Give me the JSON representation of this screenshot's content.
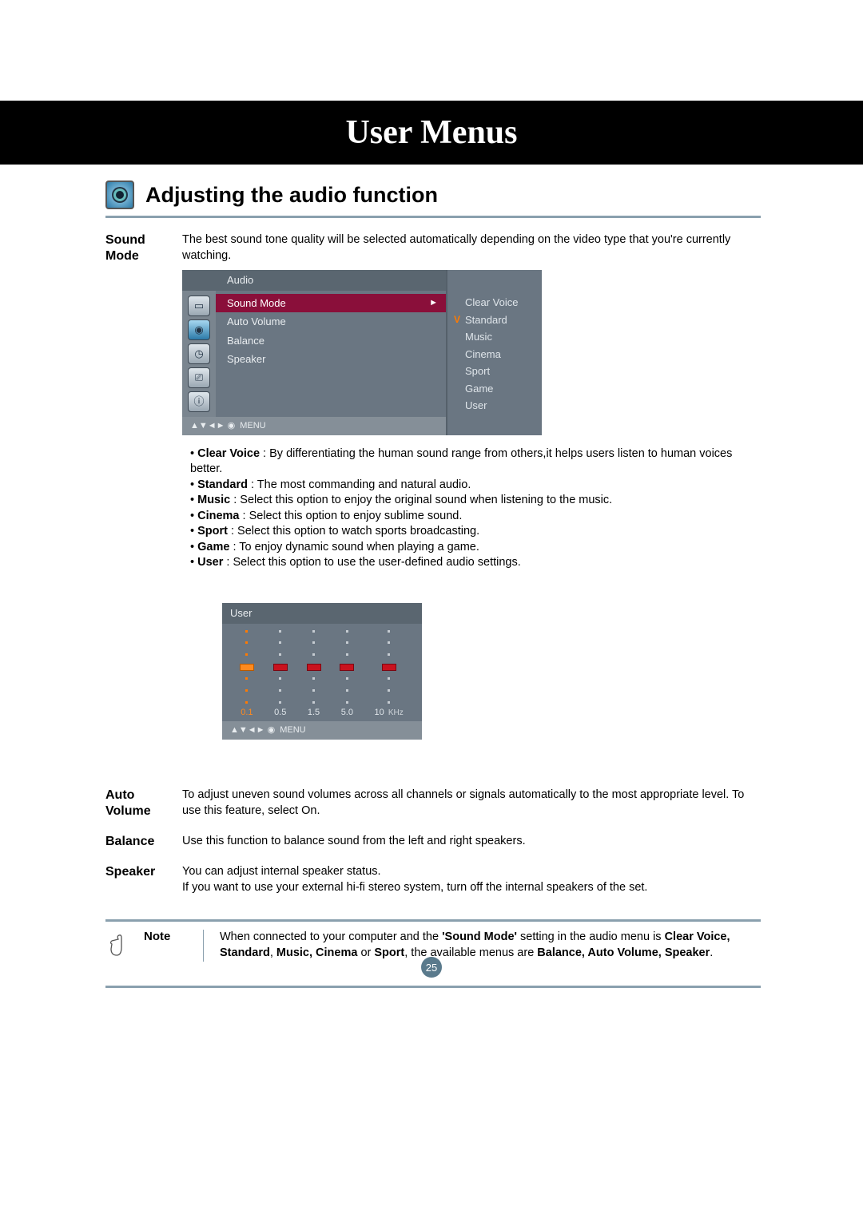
{
  "banner_title": "User Menus",
  "section_title": "Adjusting the audio function",
  "page_number": "25",
  "sound_mode": {
    "label_line1": "Sound",
    "label_line2": "Mode",
    "intro": "The best sound tone quality will be selected automatically depending on the video type that you're currently watching."
  },
  "osd": {
    "title": "Audio",
    "items": [
      "Sound Mode",
      "Auto Volume",
      "Balance",
      "Speaker"
    ],
    "selected_index": 0,
    "footer_nav": "▲▼◄► ◉",
    "footer_menu": "MENU",
    "submenu": [
      "Clear Voice",
      "Standard",
      "Music",
      "Cinema",
      "Sport",
      "Game",
      "User"
    ],
    "submenu_checked_index": 1
  },
  "mode_descriptions": [
    {
      "name": "Clear Voice",
      "desc": " : By differentiating the human sound range from others,it helps users listen to human voices better."
    },
    {
      "name": "Standard",
      "desc": " : The most commanding and natural audio."
    },
    {
      "name": "Music",
      "desc": " : Select this option to enjoy the original sound when listening to the music."
    },
    {
      "name": "Cinema",
      "desc": " : Select this option to enjoy sublime sound."
    },
    {
      "name": "Sport",
      "desc": " : Select this option to watch sports broadcasting."
    },
    {
      "name": "Game",
      "desc": " : To enjoy dynamic sound when playing a game."
    },
    {
      "name": "User",
      "desc": " : Select this option to use the user-defined audio settings."
    }
  ],
  "equalizer": {
    "title": "User",
    "bands": [
      "0.1",
      "0.5",
      "1.5",
      "5.0",
      "10"
    ],
    "unit": "KHz",
    "selected_band_index": 0,
    "footer_nav": "▲▼◄► ◉",
    "footer_menu": "MENU"
  },
  "definitions": {
    "auto_volume": {
      "label": "Auto Volume",
      "text": "To adjust uneven sound volumes across all channels or signals automatically to the most appropriate level. To use this feature, select On."
    },
    "balance": {
      "label": "Balance",
      "text": "Use this function to balance sound from the left and right speakers."
    },
    "speaker": {
      "label": "Speaker",
      "text": "You can adjust internal speaker status.\nIf you want to use your external hi-fi stereo system, turn off the internal speakers of the set."
    }
  },
  "note": {
    "label": "Note",
    "text_pre": "When connected to your computer and the ",
    "bold1": "'Sound Mode'",
    "text_mid1": " setting in the audio menu is ",
    "bold2": "Clear Voice, Standard",
    "text_mid2": ", ",
    "bold3": "Music, Cinema",
    "text_mid3": " or ",
    "bold4": "Sport",
    "text_mid4": ", the available menus are ",
    "bold5": "Balance, Auto Volume, Speaker",
    "text_end": "."
  }
}
